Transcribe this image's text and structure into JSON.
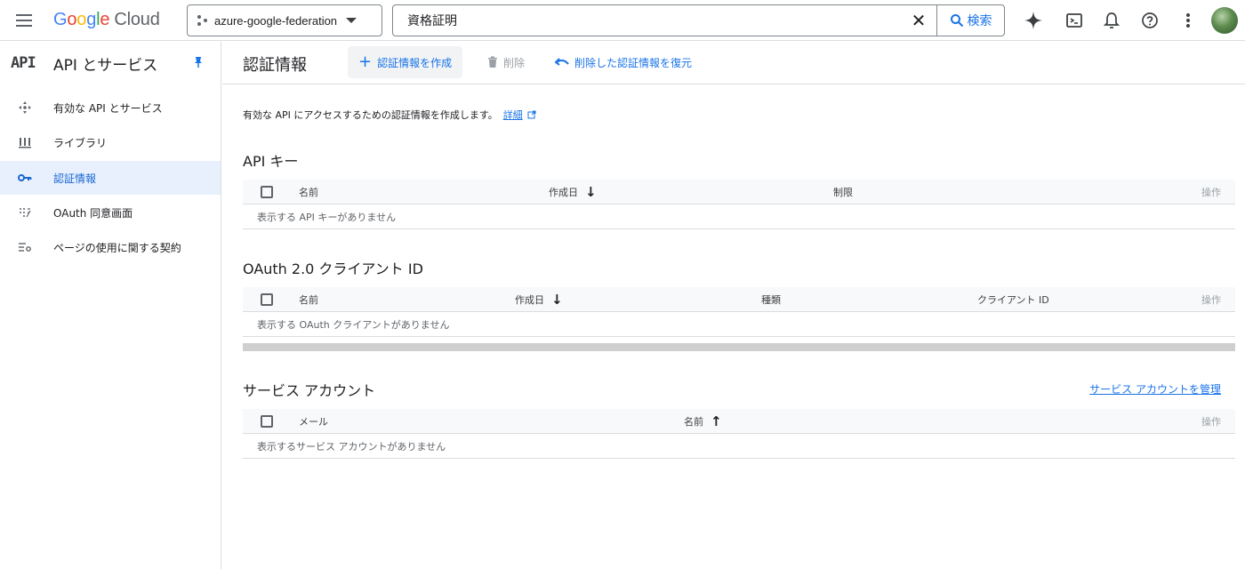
{
  "topbar": {
    "logo_google": "Google",
    "logo_cloud": "Cloud",
    "project_name": "azure-google-federation",
    "search_value": "資格証明",
    "search_button": "検索"
  },
  "sidebar": {
    "api_mark": "API",
    "title": "API とサービス",
    "items": [
      {
        "label": "有効な API とサービス",
        "icon": "enabled-apis-icon"
      },
      {
        "label": "ライブラリ",
        "icon": "library-icon"
      },
      {
        "label": "認証情報",
        "icon": "key-icon",
        "active": true
      },
      {
        "label": "OAuth 同意画面",
        "icon": "consent-icon"
      },
      {
        "label": "ページの使用に関する契約",
        "icon": "settings-list-icon"
      }
    ]
  },
  "toolbar": {
    "page_title": "認証情報",
    "create_label": "認証情報を作成",
    "delete_label": "削除",
    "restore_label": "削除した認証情報を復元"
  },
  "intro": {
    "text": "有効な API にアクセスするための認証情報を作成します。",
    "link": "詳細"
  },
  "api_keys": {
    "title": "API キー",
    "columns": [
      "名前",
      "作成日",
      "制限",
      "操作"
    ],
    "empty": "表示する API キーがありません"
  },
  "oauth_clients": {
    "title": "OAuth 2.0 クライアント ID",
    "columns": [
      "名前",
      "作成日",
      "種類",
      "クライアント ID",
      "操作"
    ],
    "empty": "表示する OAuth クライアントがありません"
  },
  "service_accounts": {
    "title": "サービス アカウント",
    "manage_link": "サービス アカウントを管理",
    "columns": [
      "メール",
      "名前",
      "操作"
    ],
    "empty": "表示するサービス アカウントがありません"
  },
  "colors": {
    "accent": "#1a73e8",
    "active_bg": "#e8f0fe",
    "border": "#dadce0"
  }
}
